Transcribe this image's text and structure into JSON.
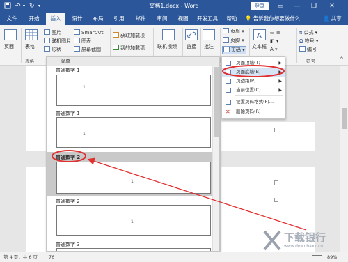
{
  "titlebar": {
    "title": "文档1.docx - Word",
    "login": "登录",
    "save_icon": "save-icon",
    "undo_symbol": "↶",
    "redo_symbol": "↻",
    "customize_symbol": "▾",
    "window_controls": [
      "▭",
      "—",
      "❐",
      "✕"
    ]
  },
  "tabs": [
    "文件",
    "开始",
    "插入",
    "设计",
    "布局",
    "引用",
    "邮件",
    "审阅",
    "视图",
    "开发工具",
    "帮助"
  ],
  "active_tab": "插入",
  "tell_me": "告诉我你想要做什么",
  "share": "共享",
  "ribbon": {
    "pages": "页面",
    "table": "表格",
    "table_group": "表格",
    "picture": "图片",
    "online_picture": "联机图片",
    "shapes": "形状",
    "smartart": "SmartArt",
    "chart": "图表",
    "screenshot": "屏幕截图",
    "get_addins": "获取加载项",
    "my_addins": "我的加载项",
    "online_video": "联机视频",
    "links": "链接",
    "comment": "批注",
    "header": "页眉",
    "footer": "页脚",
    "page_number": "页码",
    "textbox": "文本框",
    "formula": "公式",
    "symbol": "符号",
    "numbering": "编号",
    "symbol_group": "符号"
  },
  "gallery": {
    "category": "简单",
    "items": [
      {
        "label": "普通数字 1",
        "num": "1",
        "align": "center",
        "selected": false
      },
      {
        "label": "普通数字 1",
        "num": "1",
        "align": "center",
        "selected": false
      },
      {
        "label": "普通数字 2",
        "num": "1",
        "align": "center",
        "selected": true
      },
      {
        "label": "普通数字 2",
        "num": "1",
        "align": "center",
        "selected": false
      },
      {
        "label": "普通数字 3",
        "num": "1",
        "align": "right",
        "selected": false
      }
    ]
  },
  "menu": {
    "items": [
      {
        "label": "页面顶端(T)",
        "has_arrow": true
      },
      {
        "label": "页面底端(B)",
        "has_arrow": true
      },
      {
        "label": "页边距(P)",
        "has_arrow": true
      },
      {
        "label": "当前位置(C)",
        "has_arrow": true
      },
      {
        "label": "设置页码格式(F)...",
        "has_arrow": false
      },
      {
        "label": "删除页码(R)",
        "has_arrow": false
      }
    ],
    "highlighted_index": 1
  },
  "statusbar": {
    "page_info": "第 4 页，共 6 页",
    "word_count": "76",
    "zoom": "89%"
  },
  "watermark": {
    "text": "下载银行",
    "url": "www.downbank.cn"
  },
  "colors": {
    "word_blue": "#2b579a",
    "annotation_red": "#e03030"
  }
}
